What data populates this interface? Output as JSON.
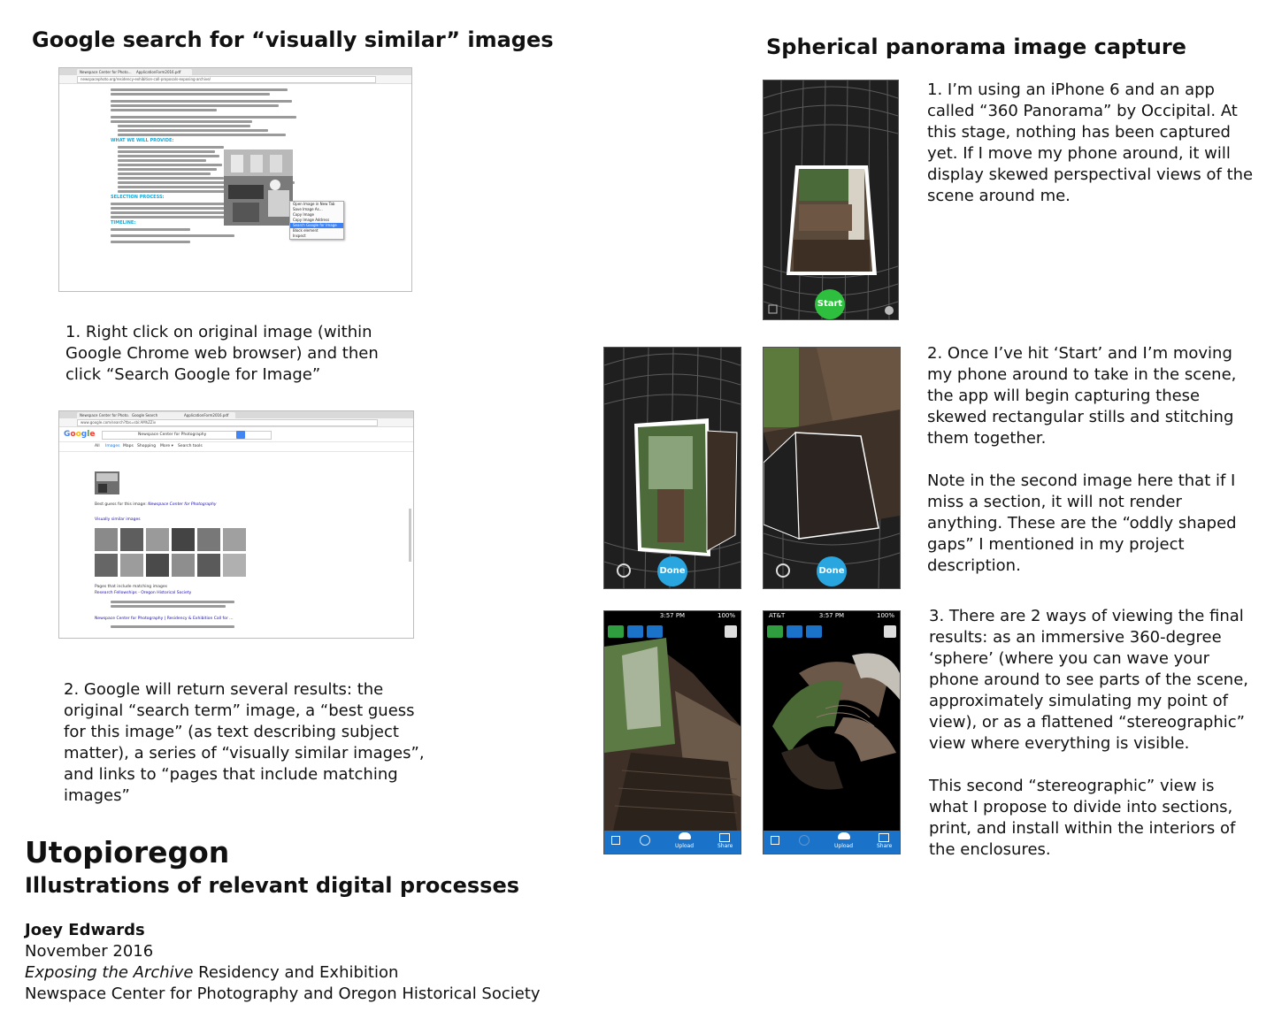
{
  "left_section": {
    "title": "Google search for “visually similar” images",
    "screenshot1": {
      "tabs": [
        "Newspace Center for Photo…",
        "ApplicationForm2016.pdf"
      ],
      "url": "newspacephoto.org/residency-exhibition-call-proposals-exposing-archive/",
      "context_menu": [
        "Open Image in New Tab",
        "Save Image As…",
        "Copy Image",
        "Copy Image Address",
        "Search Google for Image",
        "Block element",
        "Inspect"
      ],
      "headings": [
        "WHAT WE WILL PROVIDE:",
        "SELECTION PROCESS:",
        "TIMELINE:"
      ]
    },
    "step1": "1. Right click on original image (within Google Chrome web browser) and then click “Search Google for Image”",
    "screenshot2": {
      "tabs": [
        "Newspace Center for Photo…",
        "Google Search",
        "ApplicationForm2016.pdf"
      ],
      "url": "www.google.com/search?tbs=sbi:AMhZZiv",
      "search_query": "Newspace Center for Photography",
      "nav": [
        "All",
        "Images",
        "Maps",
        "Shopping",
        "More ▾",
        "Search tools"
      ],
      "best_guess_label": "Best guess for this image:",
      "best_guess_value": "Newspace Center for Photography",
      "visually_similar": "Visually similar images",
      "pages_label": "Pages that include matching images",
      "result1": "Research Fellowships - Oregon Historical Society",
      "result2": "Newspace Center for Photography | Residency & Exhibition Call for …"
    },
    "step2": "2. Google will return several results: the original “search term” image, a “best guess for this image” (as text describing subject matter), a series of “visually similar images”, and links to “pages that include matching images”"
  },
  "footer": {
    "title": "Utopioregon",
    "subtitle": "Illustrations of relevant digital processes",
    "author": "Joey Edwards",
    "date": "November 2016",
    "residency_italic": "Exposing the Archive",
    "residency_rest": " Residency and Exhibition",
    "org": "Newspace Center for Photography and Oregon Historical Society"
  },
  "right_section": {
    "title": "Spherical panorama image capture",
    "step1": "1. I’m using an iPhone 6 and an app called “360 Panorama” by Occipital. At this stage, nothing has been captured yet. If I move my phone around, it will display skewed perspectival views of the scene around me.",
    "start_label": "Start",
    "done_label": "Done",
    "step2a": "2. Once I’ve hit ‘Start’ and I’m moving my phone around to take in the scene, the app will begin capturing these skewed rectangular stills and stitching them together.",
    "step2b": "Note in the second image here that if I miss a section, it will not render anything. These are the “oddly shaped gaps” I mentioned in my project description.",
    "status_time": "3:57 PM",
    "status_battery": "100%",
    "status_carrier": "AT&T",
    "toolbar_upload": "Upload",
    "toolbar_share": "Share",
    "step3a": "3. There are 2 ways of viewing the final results: as an immersive 360-degree ‘sphere’ (where you can wave your phone around to see parts of the scene, approximately simulating my point of view), or as a flattened “stereographic” view where everything is visible.",
    "step3b": "This second “stereographic” view is what I propose to divide into sections, print, and install within the interiors of the enclosures."
  },
  "colors": {
    "start_green": "#2fbf3f",
    "done_blue": "#29a6e0",
    "toolbar_blue": "#1a73c8",
    "heading_cyan": "#1aa7d6"
  }
}
